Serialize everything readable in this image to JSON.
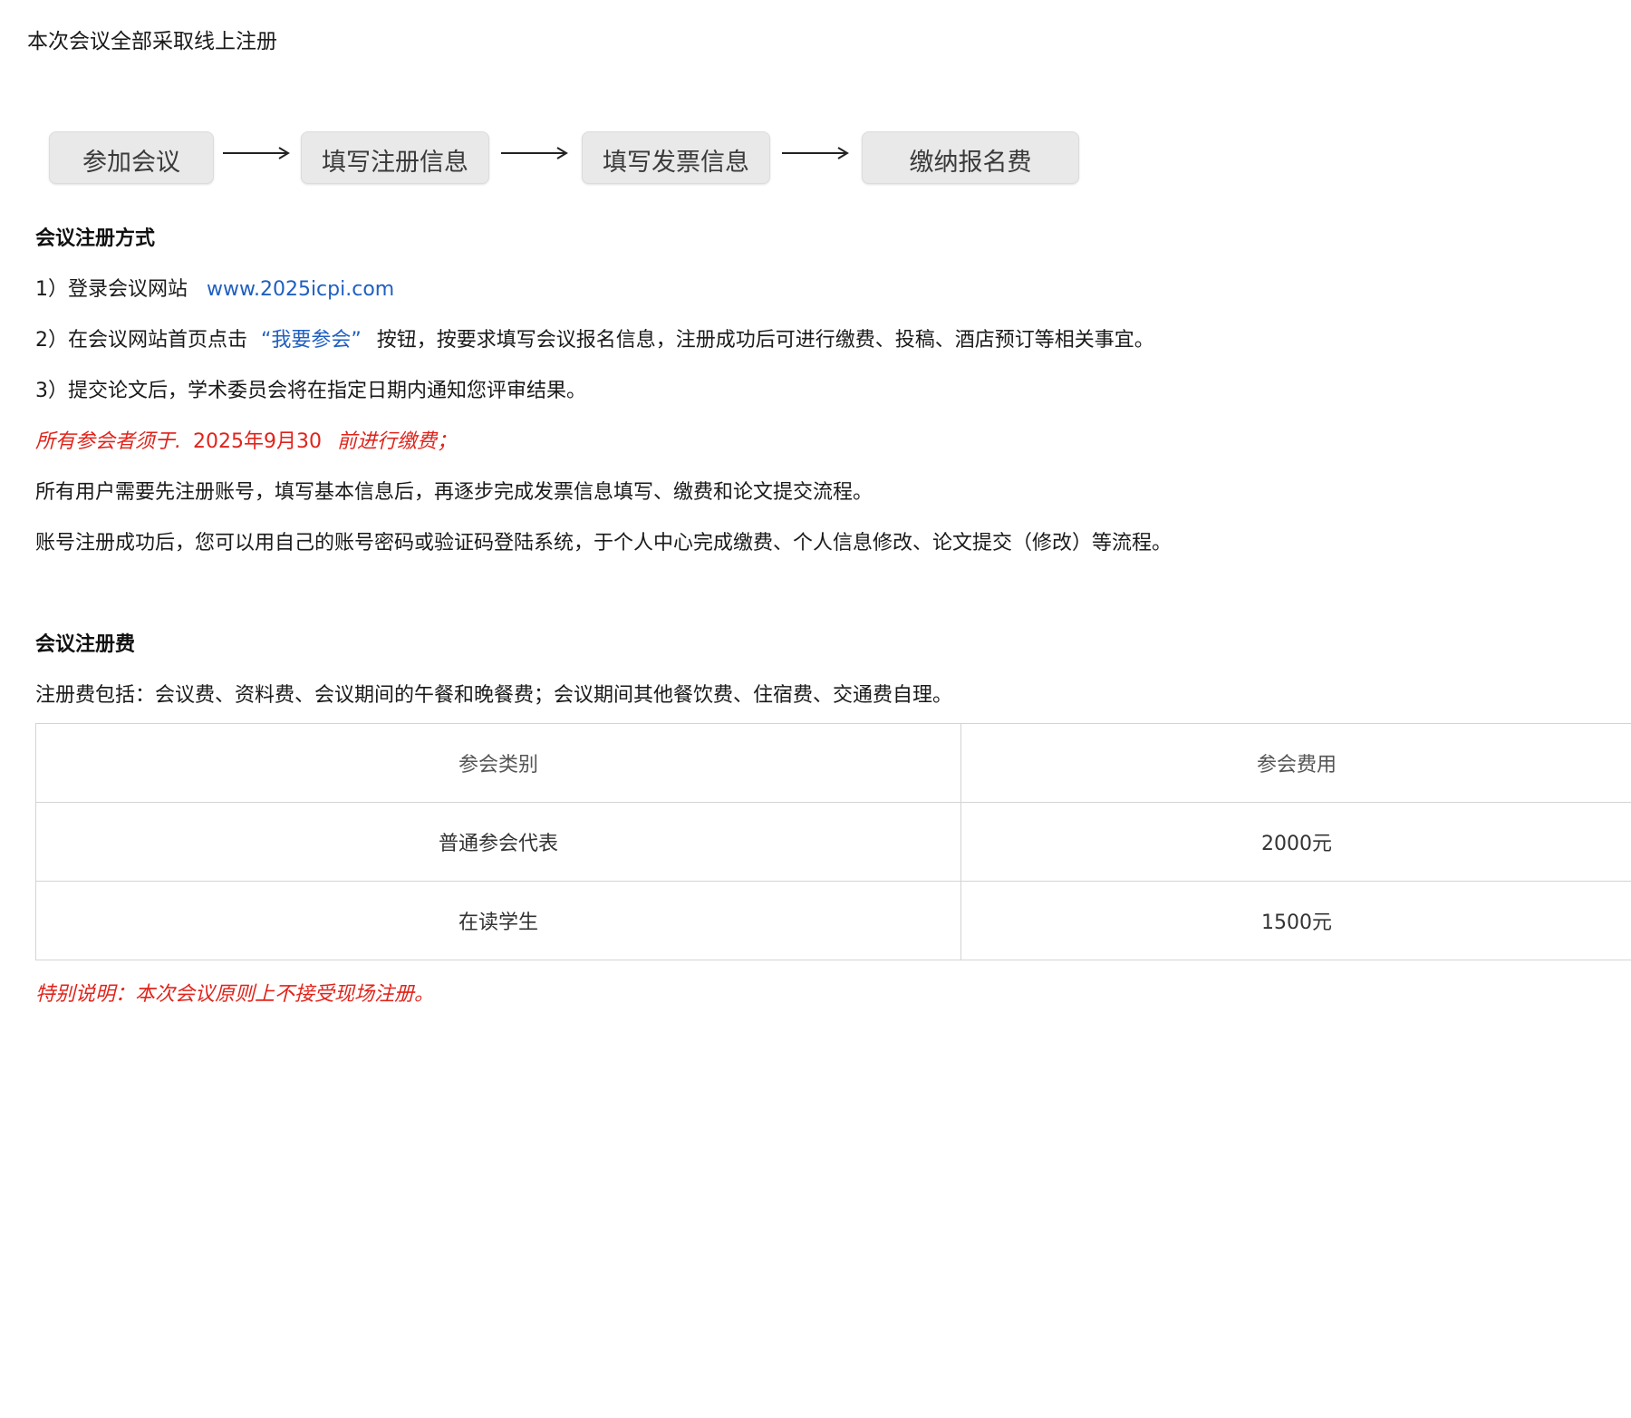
{
  "heading": "本次会议全部采取线上注册",
  "flow": {
    "steps": [
      "参加会议",
      "填写注册信息",
      "填写发票信息",
      "缴纳报名费"
    ]
  },
  "registration": {
    "title": "会议注册方式",
    "step1_prefix": "1）登录会议网站",
    "step1_link": "www.2025icpi.com",
    "step2_prefix": "2）在会议网站首页点击",
    "step2_link": "“我要参会”",
    "step2_suffix": "按钮，按要求填写会议报名信息，注册成功后可进行缴费、投稿、酒店预订等相关事宜。",
    "step3": "3）提交论文后，学术委员会将在指定日期内通知您评审结果。",
    "deadline_prefix": "所有参会者须于",
    "deadline_date": "2025年9月30",
    "deadline_suffix": "前进行缴费；",
    "info1": "所有用户需要先注册账号，填写基本信息后，再逐步完成发票信息填写、缴费和论文提交流程。",
    "info2": "账号注册成功后，您可以用自己的账号密码或验证码登陆系统，于个人中心完成缴费、个人信息修改、论文提交（修改）等流程。"
  },
  "fees": {
    "title": "会议注册费",
    "description": "注册费包括：会议费、资料费、会议期间的午餐和晚餐费；会议期间其他餐饮费、住宿费、交通费自理。",
    "table": {
      "headers": [
        "参会类别",
        "参会费用"
      ],
      "rows": [
        [
          "普通参会代表",
          "2000元"
        ],
        [
          "在读学生",
          "1500元"
        ]
      ]
    },
    "note": "特别说明：本次会议原则上不接受现场注册。"
  },
  "colors": {
    "link": "#1f5fc1",
    "highlight": "#e0241b"
  }
}
